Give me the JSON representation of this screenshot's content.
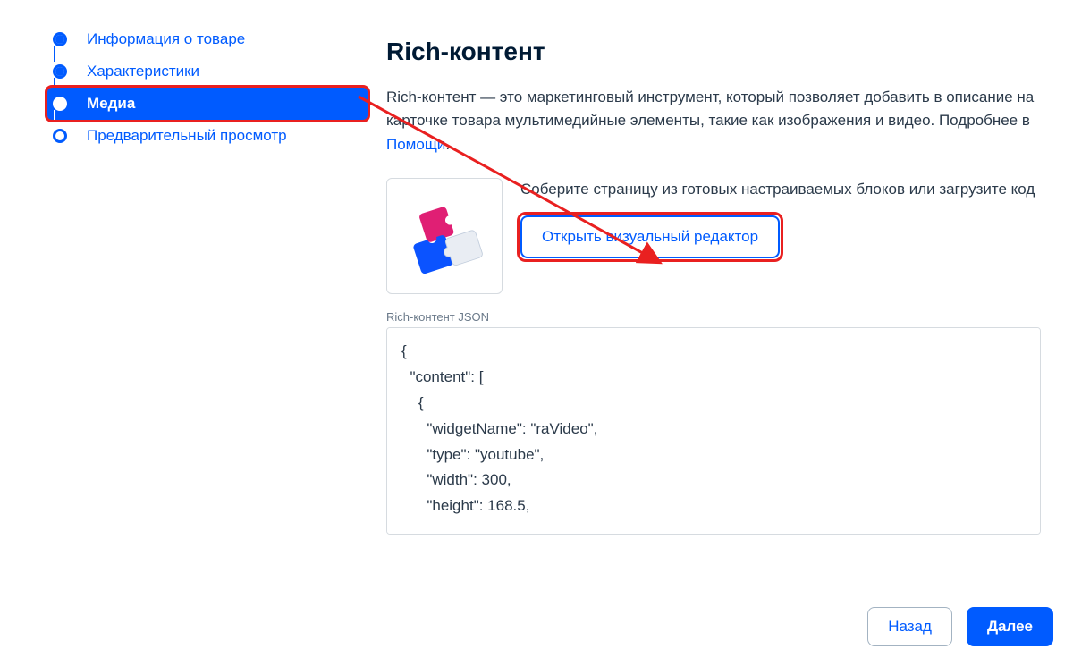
{
  "stepper": {
    "items": [
      {
        "label": "Информация о товаре",
        "state": "done"
      },
      {
        "label": "Характеристики",
        "state": "done"
      },
      {
        "label": "Медиа",
        "state": "active"
      },
      {
        "label": "Предварительный просмотр",
        "state": "open"
      }
    ]
  },
  "main": {
    "title": "Rich-контент",
    "description_lead": "Rich-контент — это маркетинговый инструмент, который позволяет добавить в описание на карточке товара мультимедийные элементы, такие как изображения и видео. Подробнее в ",
    "help_link_label": "Помощи",
    "description_trail": ".",
    "promo_text": "Соберите страницу из готовых настраиваемых блоков или загрузите код",
    "open_editor_button": "Открыть визуальный редактор",
    "json_label": "Rich-контент JSON",
    "json_value": "{\n  \"content\": [\n    {\n      \"widgetName\": \"raVideo\",\n      \"type\": \"youtube\",\n      \"width\": 300,\n      \"height\": 168.5,\n"
  },
  "footer": {
    "back_label": "Назад",
    "next_label": "Далее"
  }
}
